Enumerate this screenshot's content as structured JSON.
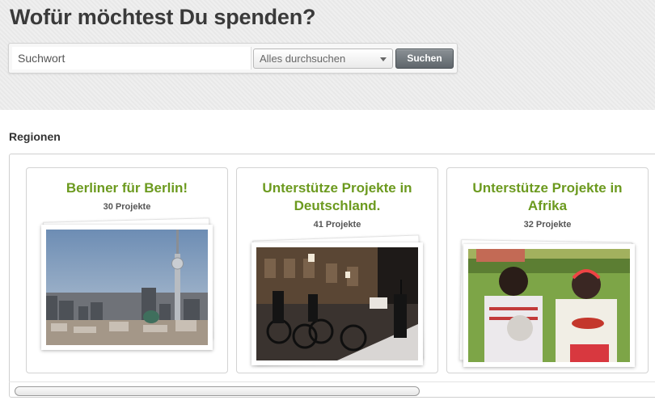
{
  "search": {
    "headline": "Wofür möchtest Du spenden?",
    "placeholder": "Suchwort",
    "scope_selected": "Alles durchsuchen",
    "submit_label": "Suchen"
  },
  "regions": {
    "title": "Regionen",
    "cards": [
      {
        "title": "Berliner für Berlin!",
        "count": "30 Projekte",
        "image": "berlin-skyline-tv-tower-photo"
      },
      {
        "title": "Unterstütze Projekte in Deutschland.",
        "count": "41 Projekte",
        "image": "night-street-bicycles-photo"
      },
      {
        "title": "Unterstütze Projekte in Afrika",
        "count": "32 Projekte",
        "image": "african-children-eating-photo"
      }
    ]
  }
}
